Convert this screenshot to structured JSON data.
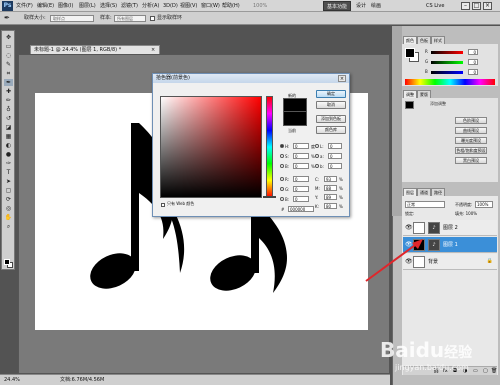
{
  "app": {
    "logo": "Ps",
    "menus": [
      "文件(F)",
      "编辑(E)",
      "图像(I)",
      "图层(L)",
      "选择(S)",
      "滤镜(T)",
      "分析(A)",
      "3D(D)",
      "视图(V)",
      "窗口(W)",
      "帮助(H)"
    ],
    "zoom_menu": "100%",
    "workspace": "基本功能",
    "design": "设计",
    "painting": "绘画",
    "cs_live": "CS Live"
  },
  "options": {
    "sample_label": "取样大小:",
    "sample_value": "取样点",
    "sample2_label": "样本:",
    "sample2_value": "所有图层",
    "show_ring": "显示取样环"
  },
  "document": {
    "tab_title": "未标题-1 @ 24.4% (图层 1, RGB/8) *",
    "tab_close": "×",
    "status_zoom": "24.4%",
    "status_doc": "文档:6.76M/4.56M"
  },
  "dialog": {
    "title": "拾色器(前景色)",
    "close": "×",
    "new_label": "新的",
    "current_label": "当前",
    "btn_ok": "确定",
    "btn_cancel": "取消",
    "btn_add_swatch": "添加到色板",
    "btn_libraries": "颜色库",
    "only_web": "只有 Web 颜色",
    "hex_label": "#",
    "hex_value": "000000",
    "fields_hsb": [
      {
        "label": "H:",
        "value": "0",
        "unit": "度",
        "on": true
      },
      {
        "label": "S:",
        "value": "0",
        "unit": "%",
        "on": false
      },
      {
        "label": "B:",
        "value": "0",
        "unit": "%",
        "on": false
      },
      {
        "label": "R:",
        "value": "0",
        "unit": "",
        "on": false
      },
      {
        "label": "G:",
        "value": "0",
        "unit": "",
        "on": false
      },
      {
        "label": "B:",
        "value": "0",
        "unit": "",
        "on": false
      }
    ],
    "fields_lab": [
      {
        "label": "L:",
        "value": "0",
        "unit": ""
      },
      {
        "label": "a:",
        "value": "0",
        "unit": ""
      },
      {
        "label": "b:",
        "value": "0",
        "unit": ""
      },
      {
        "label": "C:",
        "value": "93",
        "unit": "%"
      },
      {
        "label": "M:",
        "value": "88",
        "unit": "%"
      },
      {
        "label": "Y:",
        "value": "89",
        "unit": "%"
      },
      {
        "label": "K:",
        "value": "80",
        "unit": "%"
      }
    ]
  },
  "panels": {
    "color_tabs": [
      "颜色",
      "色板",
      "样式"
    ],
    "rgb": [
      {
        "label": "R",
        "value": "0",
        "color": "#d93030"
      },
      {
        "label": "G",
        "value": "0",
        "color": "#2fae2f"
      },
      {
        "label": "B",
        "value": "0",
        "color": "#2f4fd0"
      }
    ],
    "adjust_tabs": [
      "调整",
      "蒙版"
    ],
    "adjust_title": "添加调整",
    "adjust_buttons": [
      "色阶预设",
      "曲线预设",
      "曝光度预设",
      "色相/饱和度预设",
      "黑白预设"
    ],
    "layer_tabs": [
      "图层",
      "通道",
      "路径"
    ],
    "blend_mode": "正常",
    "opacity_label": "不透明度:",
    "opacity_value": "100%",
    "lock_label": "锁定:",
    "fill_label": "填充:",
    "fill_value": "100%",
    "layers": [
      {
        "name": "图层 2",
        "selected": false,
        "fill": "white",
        "has_mask": true
      },
      {
        "name": "图层 1",
        "selected": true,
        "fill": "black",
        "has_mask": true
      },
      {
        "name": "背景",
        "selected": false,
        "fill": "white",
        "has_mask": false
      }
    ]
  },
  "watermark": {
    "brand": "Baidu",
    "brand_cn": "经验",
    "url": "jingyan.baidu.com"
  },
  "colors": {
    "arrow": "#e0262b",
    "selection": "#3b8fd8"
  }
}
